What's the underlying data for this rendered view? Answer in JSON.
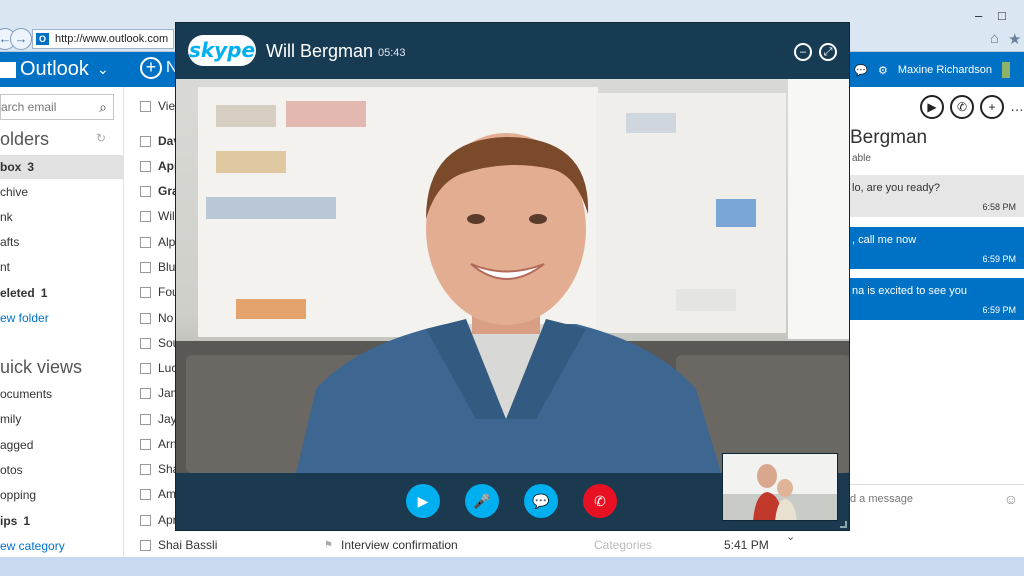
{
  "browser": {
    "url": "http://www.outlook.com",
    "favicon_letter": "O",
    "window_controls": [
      "–",
      "□"
    ],
    "toolbar_icons": [
      "home-icon",
      "star-icon"
    ]
  },
  "outlook": {
    "brand": "Outlook",
    "new_label": "N",
    "user_name": "Maxine Richardson",
    "search_placeholder": "arch email",
    "folders_heading": "olders",
    "folders": [
      {
        "label": "box",
        "count": "3",
        "bold": true,
        "selected": true
      },
      {
        "label": "chive",
        "count": "",
        "bold": false
      },
      {
        "label": "nk",
        "count": "",
        "bold": false
      },
      {
        "label": "afts",
        "count": "",
        "bold": false
      },
      {
        "label": "nt",
        "count": "",
        "bold": false
      },
      {
        "label": "eleted",
        "count": "1",
        "bold": true
      },
      {
        "label": "ew folder",
        "count": "",
        "bold": false,
        "link": true
      }
    ],
    "quick_views_heading": "uick views",
    "quick_views": [
      {
        "label": "ocuments",
        "count": ""
      },
      {
        "label": "mily",
        "count": ""
      },
      {
        "label": "agged",
        "count": ""
      },
      {
        "label": "otos",
        "count": ""
      },
      {
        "label": "opping",
        "count": ""
      },
      {
        "label": "ips",
        "count": "1",
        "bold": true
      },
      {
        "label": "ew category",
        "count": "",
        "link": true
      }
    ],
    "messages": [
      {
        "sender": "Vie",
        "bold": false
      },
      {
        "sender": "Dav",
        "bold": true
      },
      {
        "sender": "Apr",
        "bold": true
      },
      {
        "sender": "Gra",
        "bold": true
      },
      {
        "sender": "Wil",
        "bold": false
      },
      {
        "sender": "Alp",
        "bold": false
      },
      {
        "sender": "Blu",
        "bold": false
      },
      {
        "sender": "Fou",
        "bold": false
      },
      {
        "sender": "No",
        "bold": false
      },
      {
        "sender": "Sou",
        "bold": false
      },
      {
        "sender": "Luc",
        "bold": false
      },
      {
        "sender": "Jam",
        "bold": false
      },
      {
        "sender": "Jay",
        "bold": false
      },
      {
        "sender": "Arn",
        "bold": false
      },
      {
        "sender": "Sha",
        "bold": false
      },
      {
        "sender": "Am",
        "bold": false
      },
      {
        "sender": "Apr",
        "bold": false
      },
      {
        "sender": "Shai Bassli",
        "bold": false,
        "subject": "Interview confirmation",
        "category": "Categories",
        "time": "5:41 PM"
      }
    ]
  },
  "chat": {
    "contact_name": "Bergman",
    "status": "able",
    "messages": [
      {
        "text": "lo, are you ready?",
        "time": "6:58 PM",
        "direction": "in"
      },
      {
        "text": ", call me now",
        "time": "6:59 PM",
        "direction": "out"
      },
      {
        "text": "na is excited to see you",
        "time": "6:59 PM",
        "direction": "out"
      }
    ],
    "input_placeholder": "d a message"
  },
  "skype": {
    "logo_text": "skype",
    "caller_name": "Will Bergman",
    "duration": "05:43"
  },
  "colors": {
    "outlook_blue": "#0072c6",
    "skype_blue": "#00aff0",
    "skype_dark": "#173b53",
    "end_call_red": "#e81123"
  }
}
